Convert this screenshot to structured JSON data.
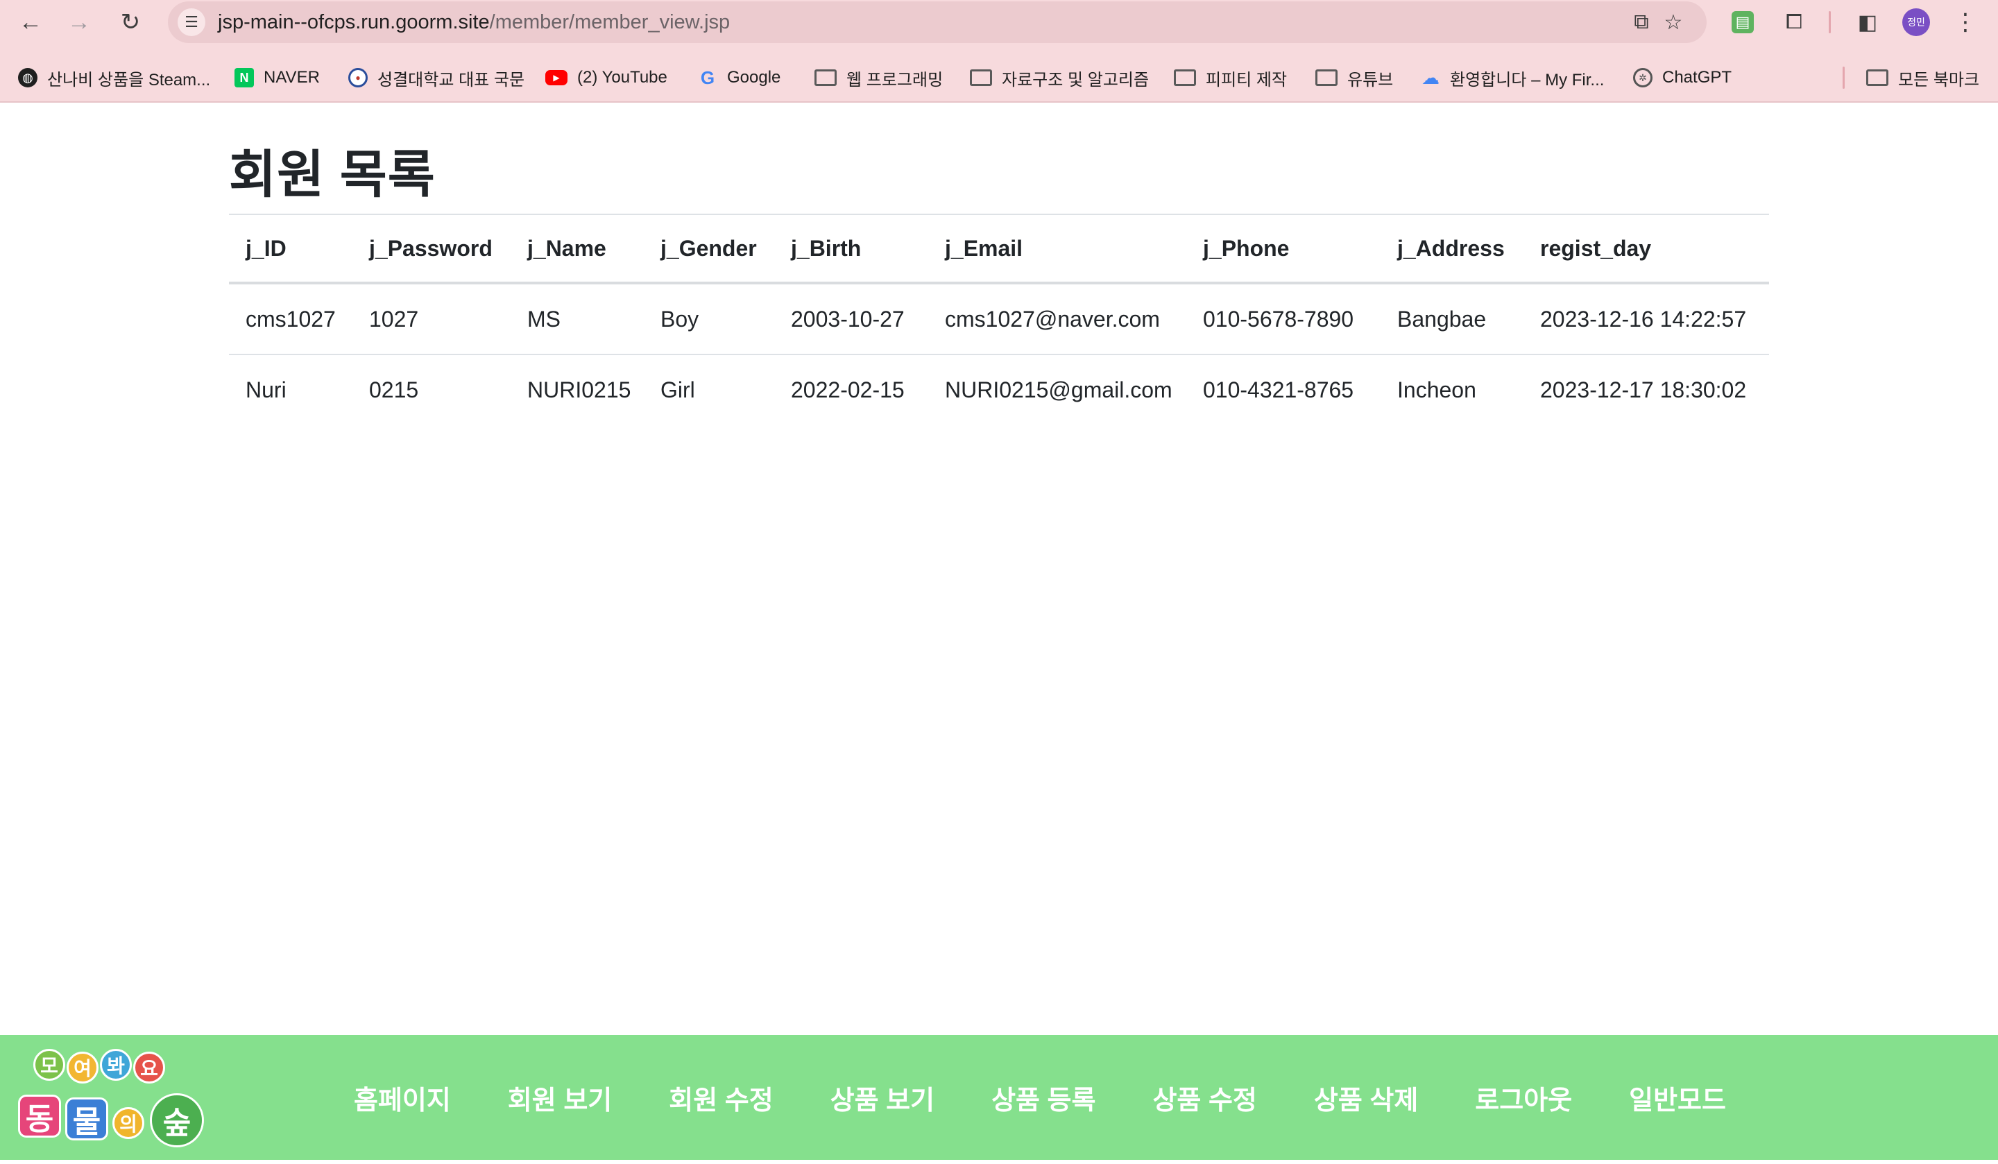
{
  "browser": {
    "url_host": "jsp-main--ofcps.run.goorm.site",
    "url_path": "/member/member_view.jsp",
    "profile_label": "정민",
    "bookmarks": [
      {
        "label": "산나비 상품을 Steam...",
        "icon": "globe-icon"
      },
      {
        "label": "NAVER",
        "icon": "naver-icon"
      },
      {
        "label": "성결대학교 대표 국문",
        "icon": "university-icon"
      },
      {
        "label": "(2) YouTube",
        "icon": "youtube-icon"
      },
      {
        "label": "Google",
        "icon": "google-icon"
      },
      {
        "label": "웹 프로그래밍",
        "icon": "folder-icon"
      },
      {
        "label": "자료구조 및 알고리즘",
        "icon": "folder-icon"
      },
      {
        "label": "피피티 제작",
        "icon": "folder-icon"
      },
      {
        "label": "유튜브",
        "icon": "folder-icon"
      },
      {
        "label": "환영합니다 – My Fir...",
        "icon": "cloud-icon"
      },
      {
        "label": "ChatGPT",
        "icon": "chatgpt-icon"
      }
    ],
    "all_bookmarks_label": "모든 북마크"
  },
  "page": {
    "title": "회원 목록"
  },
  "table": {
    "headers": [
      "j_ID",
      "j_Password",
      "j_Name",
      "j_Gender",
      "j_Birth",
      "j_Email",
      "j_Phone",
      "j_Address",
      "regist_day"
    ],
    "rows": [
      {
        "cells": [
          "cms1027",
          "1027",
          "MS",
          "Boy",
          "2003-10-27",
          "cms1027@naver.com",
          "010-5678-7890",
          "Bangbae",
          "2023-12-16 14:22:57"
        ]
      },
      {
        "cells": [
          "Nuri",
          "0215",
          "NURI0215",
          "Girl",
          "2022-02-15",
          "NURI0215@gmail.com",
          "010-4321-8765",
          "Incheon",
          "2023-12-17 18:30:02"
        ]
      }
    ]
  },
  "footer": {
    "logo": {
      "top_chars": [
        "모",
        "여",
        "봐",
        "요"
      ],
      "bottom_chars": [
        "동",
        "물",
        "의",
        "숲"
      ]
    },
    "nav": [
      "홈페이지",
      "회원 보기",
      "회원 수정",
      "상품 보기",
      "상품 등록",
      "상품 수정",
      "상품 삭제",
      "로그아웃",
      "일반모드"
    ]
  },
  "colors": {
    "chrome_bg": "#f7dadd",
    "omnibox_bg": "#eccbcf",
    "footer_bg": "#85e08d",
    "footer_text": "#ffffff",
    "text": "#212529"
  }
}
